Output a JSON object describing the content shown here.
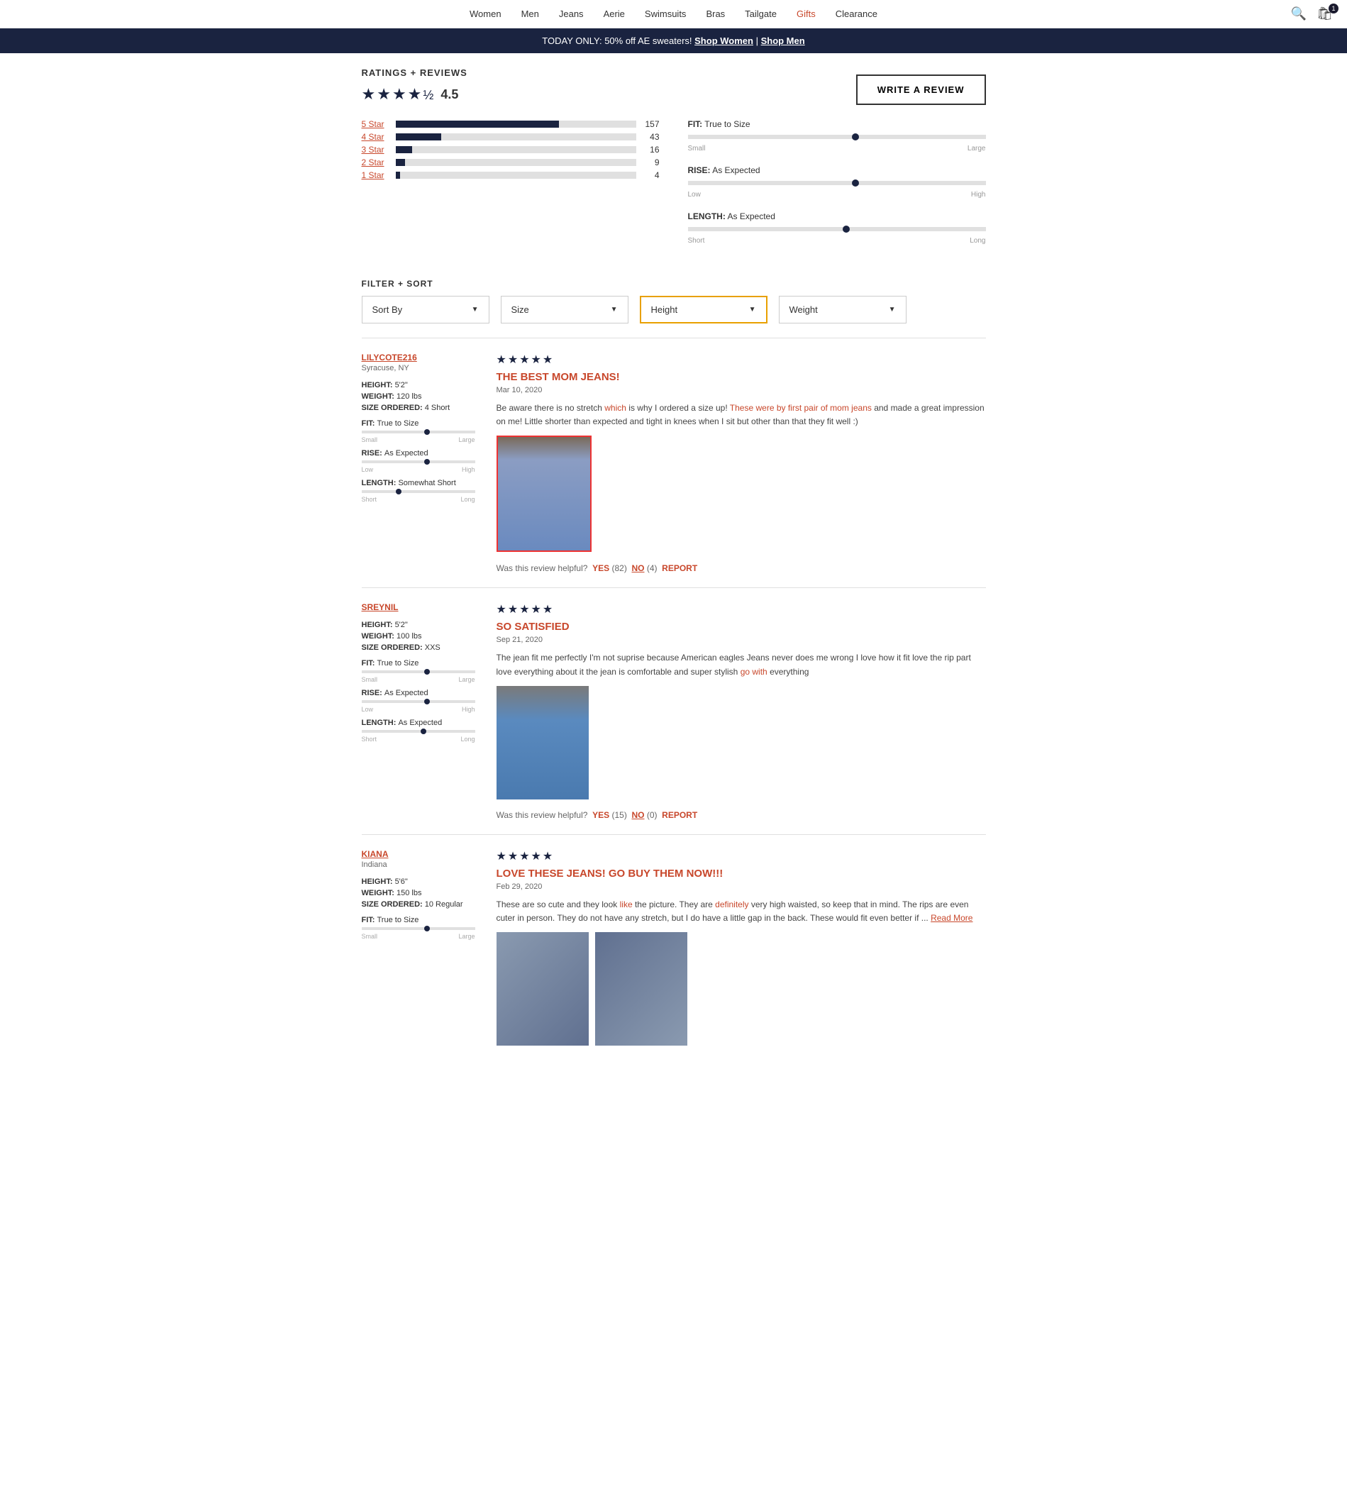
{
  "nav": {
    "items": [
      {
        "label": "Women",
        "active": false
      },
      {
        "label": "Men",
        "active": false
      },
      {
        "label": "Jeans",
        "active": false
      },
      {
        "label": "Aerie",
        "active": false
      },
      {
        "label": "Swimsuits",
        "active": false
      },
      {
        "label": "Bras",
        "active": false
      },
      {
        "label": "Tailgate",
        "active": false
      },
      {
        "label": "Gifts",
        "active": true
      },
      {
        "label": "Clearance",
        "active": false
      }
    ],
    "cart_count": "1"
  },
  "promo": {
    "text": "TODAY ONLY: 50% off AE sweaters!  ",
    "link1": "Shop Women",
    "separator": " | ",
    "link2": "Shop Men"
  },
  "ratings": {
    "section_title": "RATINGS + REVIEWS",
    "overall_score": "4.5",
    "stars_display": "★★★★½",
    "write_review_label": "WRITE A REVIEW",
    "bars": [
      {
        "label": "5 Star",
        "count": "157",
        "pct": 68
      },
      {
        "label": "4 Star",
        "count": "43",
        "pct": 19
      },
      {
        "label": "3 Star",
        "count": "16",
        "pct": 7
      },
      {
        "label": "2 Star",
        "count": "9",
        "pct": 4
      },
      {
        "label": "1 Star",
        "count": "4",
        "pct": 2
      }
    ],
    "fit_metrics": [
      {
        "id": "fit",
        "label": "FIT:",
        "value": "True to Size",
        "left": "Small",
        "right": "Large",
        "dot_pct": 55
      },
      {
        "id": "rise",
        "label": "RISE:",
        "value": "As Expected",
        "left": "Low",
        "right": "High",
        "dot_pct": 55
      },
      {
        "id": "length",
        "label": "LENGTH:",
        "value": "As Expected",
        "left": "Short",
        "right": "Long",
        "dot_pct": 52
      }
    ]
  },
  "filter": {
    "title": "FILTER + SORT",
    "dropdowns": [
      {
        "label": "Sort By",
        "active": false
      },
      {
        "label": "Size",
        "active": false
      },
      {
        "label": "Height",
        "active": true
      },
      {
        "label": "Weight",
        "active": false
      }
    ]
  },
  "reviews": [
    {
      "id": "review1",
      "username": "LILYCOTE216",
      "location": "Syracuse, NY",
      "height": "5'2\"",
      "weight": "120 lbs",
      "size_ordered": "4 Short",
      "fit": "True to Size",
      "rise": "As Expected",
      "length": "Somewhat Short",
      "stars": "★★★★★",
      "title": "THE BEST MOM JEANS!",
      "date": "Mar 10, 2020",
      "text": "Be aware there is no stretch which is why I ordered a size up! These were by first pair of mom jeans and made a great impression on me! Little shorter than expected and tight in knees when I sit but other than that they fit well :)",
      "has_image": true,
      "image_highlighted": true,
      "helpful_yes": "YES",
      "helpful_yes_count": "(82)",
      "helpful_no": "NO",
      "helpful_no_count": "(4)",
      "report": "REPORT",
      "fit_dot": 55,
      "rise_dot": 55,
      "length_dot": 35,
      "fit_label": "True to Size",
      "fit_left": "Small",
      "fit_right": "Large",
      "rise_label": "As Expected",
      "rise_left": "Low",
      "rise_right": "High",
      "length_label": "Somewhat Short",
      "length_left": "Short",
      "length_right": "Long"
    },
    {
      "id": "review2",
      "username": "SREYNIL",
      "location": "",
      "height": "5'2\"",
      "weight": "100 lbs",
      "size_ordered": "XXS",
      "fit": "True to Size",
      "rise": "As Expected",
      "length": "As Expected",
      "stars": "★★★★★",
      "title": "SO SATISFIED",
      "date": "Sep 21, 2020",
      "text": "The jean fit me perfectly I'm not suprise because American eagles Jeans never does me wrong I love how it fit love the rip part love everything about it the jean is comfortable and super stylish go with everything",
      "has_image": true,
      "image_highlighted": false,
      "helpful_yes": "YES",
      "helpful_yes_count": "(15)",
      "helpful_no": "NO",
      "helpful_no_count": "(0)",
      "report": "REPORT",
      "fit_dot": 55,
      "rise_dot": 55,
      "length_dot": 52,
      "fit_label": "True to Size",
      "fit_left": "Small",
      "fit_right": "Large",
      "rise_label": "As Expected",
      "rise_left": "Low",
      "rise_right": "High",
      "length_label": "As Expected",
      "length_left": "Short",
      "length_right": "Long"
    },
    {
      "id": "review3",
      "username": "KIANA",
      "location": "Indiana",
      "height": "5'6\"",
      "weight": "150 lbs",
      "size_ordered": "10 Regular",
      "fit": "True to Size",
      "rise": "",
      "length": "",
      "stars": "★★★★★",
      "title": "LOVE THESE JEANS! GO BUY THEM NOW!!!",
      "date": "Feb 29, 2020",
      "text": "These are so cute and they look like the picture. They are definitely very high waisted, so keep that in mind. The rips are even cuter in person. They do not have any stretch, but I do have a little gap in the back. These would fit even better if ...",
      "has_image": true,
      "image_highlighted": false,
      "has_two_images": true,
      "helpful_yes": "",
      "helpful_yes_count": "",
      "helpful_no": "",
      "helpful_no_count": "",
      "report": "",
      "read_more": "Read More",
      "fit_dot": 55,
      "rise_dot": 55,
      "length_dot": 52,
      "fit_label": "True to Size",
      "fit_left": "Small",
      "fit_right": "Large"
    }
  ]
}
